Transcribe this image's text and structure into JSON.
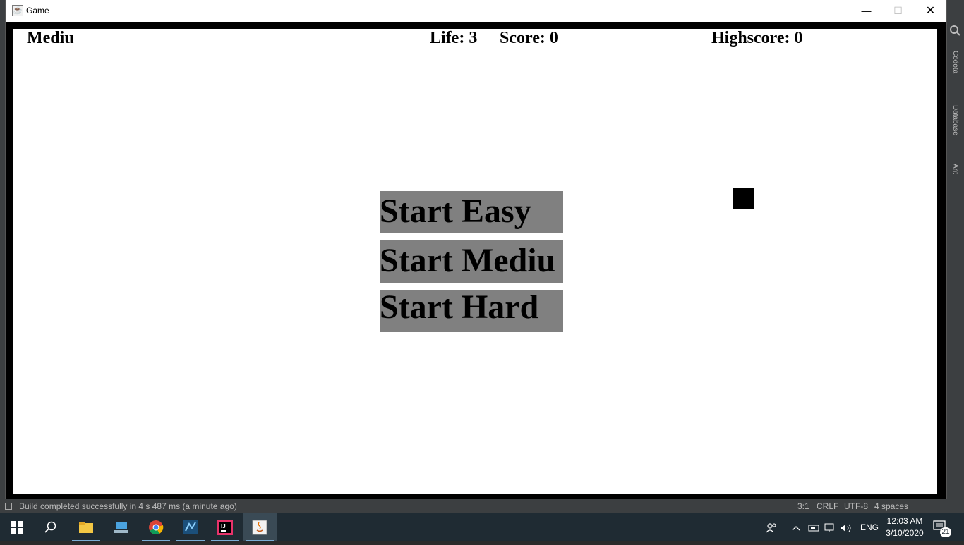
{
  "window": {
    "title": "Game",
    "app_icon": "java-icon",
    "controls": {
      "minimize": "—",
      "maximize": "☐",
      "close": "✕"
    }
  },
  "hud": {
    "mode": "Mediu",
    "life": "Life: 3",
    "score": "Score: 0",
    "highscore": "Highscore: 0"
  },
  "menu": {
    "easy": "Start Easy",
    "medium": "Start Mediu",
    "hard": "Start Hard",
    "button_color": "#808080"
  },
  "ide": {
    "tools": [
      "Codota",
      "Database",
      "Ant"
    ],
    "status_message": "Build completed successfully in 4 s 487 ms (a minute ago)",
    "position": "3:1",
    "line_ending": "CRLF",
    "encoding": "UTF-8",
    "indent": "4 spaces"
  },
  "taskbar": {
    "items": [
      "windows-start-icon",
      "search-icon",
      "file-explorer-icon",
      "app-icon",
      "chrome-icon",
      "app-icon",
      "intellij-icon",
      "java-icon"
    ],
    "language": "ENG",
    "time": "12:03 AM",
    "date": "3/10/2020",
    "notification_count": "21"
  }
}
